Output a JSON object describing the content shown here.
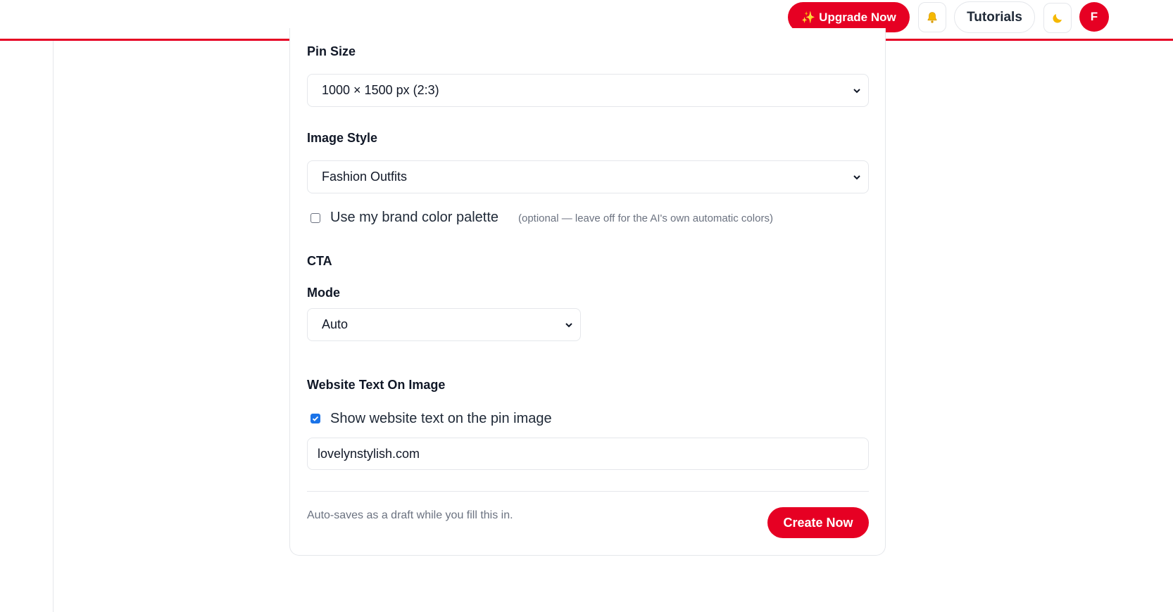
{
  "header": {
    "upgrade_icon": "sparkles-icon",
    "upgrade_label": "Upgrade Now",
    "notifications_icon": "bell-icon",
    "tutorials_label": "Tutorials",
    "theme_icon": "moon-icon",
    "avatar_initial": "F",
    "accent_color": "#e60023"
  },
  "form": {
    "pin_size": {
      "label": "Pin Size",
      "value": "1000 × 1500 px (2:3)"
    },
    "image_style": {
      "label": "Image Style",
      "value": "Fashion Outfits"
    },
    "brand_palette": {
      "label": "Use my brand color palette",
      "hint": "(optional — leave off for the AI's own automatic colors)",
      "checked": false
    },
    "cta": {
      "heading": "CTA",
      "mode_label": "Mode",
      "mode_value": "Auto"
    },
    "website_text": {
      "heading": "Website Text On Image",
      "checkbox_label": "Show website text on the pin image",
      "checked": true,
      "value": "lovelynstylish.com"
    }
  },
  "footer": {
    "note": "Auto-saves as a draft while you fill this in.",
    "create_label": "Create Now"
  }
}
